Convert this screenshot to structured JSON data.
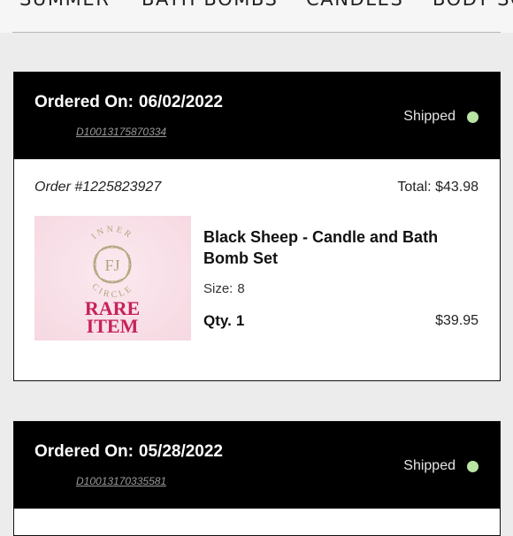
{
  "nav": {
    "items": [
      "SUMMER",
      "BATH BOMBS",
      "CANDLES",
      "BODY SC"
    ]
  },
  "orders": [
    {
      "ordered_label": "Ordered On:",
      "ordered_date": "06/02/2022",
      "tracking": "D10013175870334",
      "status": "Shipped",
      "status_color": "#b9e4a3",
      "order_number": "Order #1225823927",
      "total": "Total: $43.98",
      "item": {
        "image_alt": "Inner Circle FJ Rare Item",
        "logo_text": "INNER CIRCLE",
        "logo_monogram": "FJ",
        "logo_rare": "RARE",
        "logo_item": "ITEM",
        "name": "Black Sheep - Candle and Bath Bomb Set",
        "size_label": "Size:",
        "size_value": "8",
        "qty_label": "Qty.",
        "qty_value": "1",
        "price": "$39.95"
      }
    },
    {
      "ordered_label": "Ordered On:",
      "ordered_date": "05/28/2022",
      "tracking": "D10013170335581",
      "status": "Shipped",
      "status_color": "#b9e4a3"
    }
  ],
  "colors": {
    "brand_pink": "#c8215a",
    "gold": "#b4a27e"
  }
}
